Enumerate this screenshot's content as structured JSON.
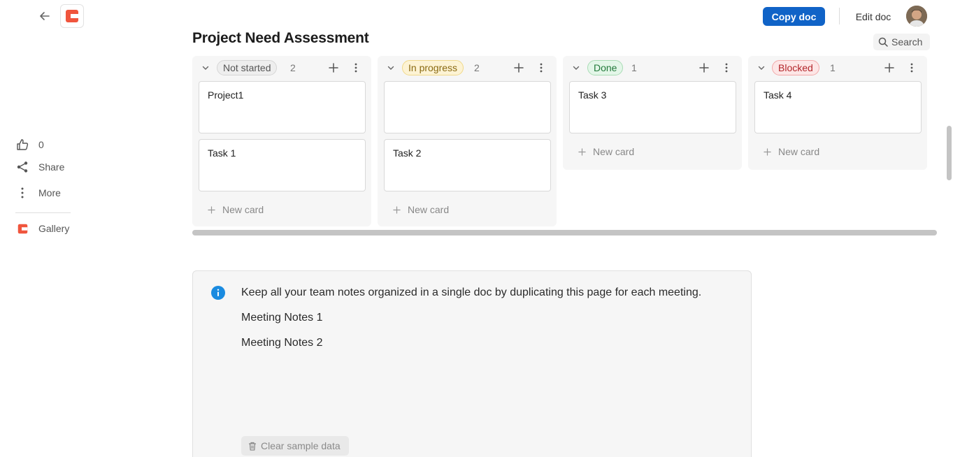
{
  "header": {
    "copy_label": "Copy doc",
    "edit_label": "Edit doc",
    "search_label": "Search"
  },
  "page": {
    "title": "Project Need Assessment"
  },
  "rail": {
    "likes_count": "0",
    "share_label": "Share",
    "more_label": "More",
    "gallery_label": "Gallery"
  },
  "board": {
    "new_card_label": "New card",
    "columns": [
      {
        "status": "Not started",
        "count": "2",
        "pill_bg": "#eeeeee",
        "pill_border": "#d6d6d6",
        "pill_color": "#555555",
        "cards": [
          "Project1",
          "Task 1"
        ]
      },
      {
        "status": "In progress",
        "count": "2",
        "pill_bg": "#fdf3d4",
        "pill_border": "#f0d98a",
        "pill_color": "#8a6a12",
        "cards": [
          "",
          "Task 2"
        ]
      },
      {
        "status": "Done",
        "count": "1",
        "pill_bg": "#e3f6e8",
        "pill_border": "#a9dcb5",
        "pill_color": "#237a3b",
        "cards": [
          "Task 3"
        ]
      },
      {
        "status": "Blocked",
        "count": "1",
        "pill_bg": "#fde6e6",
        "pill_border": "#f2a9a9",
        "pill_color": "#b2262a",
        "cards": [
          "Task 4"
        ]
      }
    ]
  },
  "callout": {
    "intro": "Keep all your team notes organized in a single doc by duplicating this page for each meeting.",
    "notes": [
      "Meeting Notes 1",
      "Meeting Notes 2"
    ],
    "clear_label": "Clear sample data"
  },
  "colors": {
    "accent": "#1063c7",
    "brand": "#f0553d",
    "info": "#1a8be0"
  }
}
